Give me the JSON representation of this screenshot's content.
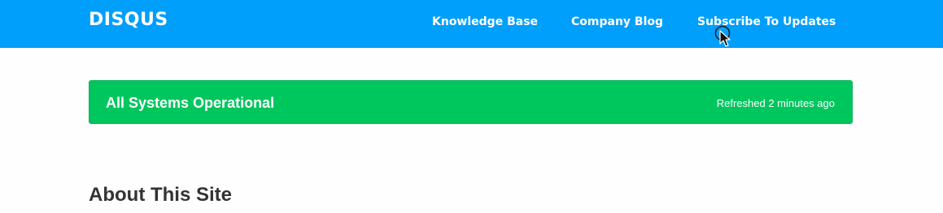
{
  "header": {
    "logo": "DISQUS",
    "nav": {
      "knowledge_base": "Knowledge Base",
      "company_blog": "Company Blog",
      "subscribe": "Subscribe To Updates"
    }
  },
  "status": {
    "label": "All Systems Operational",
    "refreshed": "Refreshed 2 minutes ago"
  },
  "main": {
    "about_title": "About This Site"
  },
  "colors": {
    "header_bg": "#009ffc",
    "status_green": "#00c65e",
    "heading_text": "#333333"
  },
  "icons": {
    "cursor": "mouse-pointer-icon"
  }
}
